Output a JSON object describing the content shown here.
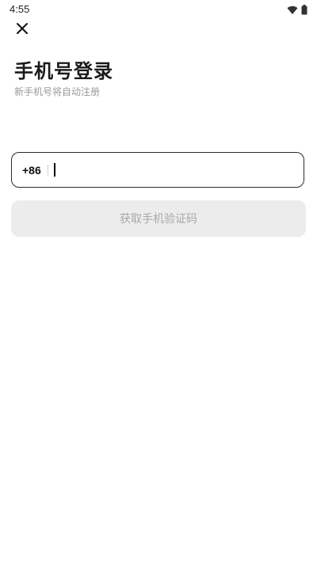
{
  "status_bar": {
    "time": "4:55",
    "icons": [
      "wifi-icon",
      "battery-icon"
    ]
  },
  "header": {
    "close_icon": "close-icon"
  },
  "login": {
    "title": "手机号登录",
    "subtitle": "新手机号将自动注册",
    "country_code": "+86",
    "phone_value": "",
    "phone_placeholder": "",
    "get_code_label": "获取手机验证码"
  },
  "colors": {
    "button_bg_disabled": "#ececec",
    "button_text_disabled": "#a8a8a8",
    "field_border": "#2a2a2a",
    "subtitle": "#9a9a9a"
  }
}
